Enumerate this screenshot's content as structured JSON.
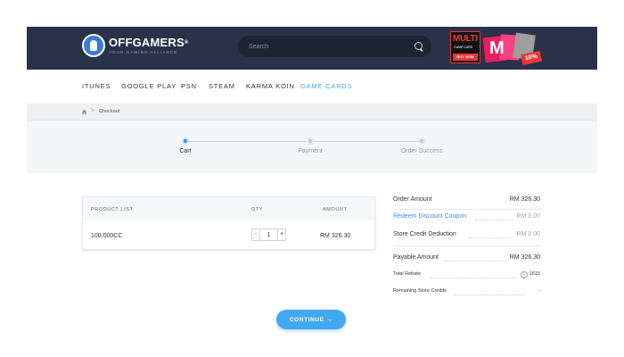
{
  "header": {
    "logo_name": "OFFGAMERS",
    "logo_reg": "®",
    "logo_tagline": "YOUR GAMING ALLIANCE",
    "search_placeholder": "Search",
    "promo": {
      "multi_text": "MULTI",
      "sub_text": "GAME CARD",
      "buy_text": "BUY NOW",
      "m_text": "M",
      "off_text": "10%"
    }
  },
  "nav": {
    "items": [
      {
        "label": "ITUNES",
        "active": false
      },
      {
        "label": "GOOGLE PLAY",
        "active": false
      },
      {
        "label": "PSN",
        "active": false
      },
      {
        "label": "STEAM",
        "active": false
      },
      {
        "label": "KARMA KOIN",
        "active": false
      },
      {
        "label": "GAME CARDS",
        "active": true
      }
    ]
  },
  "breadcrumb": {
    "separator": ">",
    "current": "Checkout"
  },
  "steps": [
    {
      "label": "Cart",
      "active": true
    },
    {
      "label": "Payment",
      "active": false
    },
    {
      "label": "Order Success",
      "active": false
    }
  ],
  "table": {
    "headers": {
      "product": "PRODUCT LIST",
      "qty": "QTY",
      "amount": "AMOUNT"
    },
    "rows": [
      {
        "product": "100,000CC",
        "qty": "1",
        "amount": "RM 326.30"
      }
    ],
    "minus": "-",
    "plus": "+"
  },
  "summary": {
    "order_amount_label": "Order Amount",
    "order_amount_value": "RM 326.30",
    "discount_label": "Redeem Discount Coupon",
    "discount_value": "RM 0.00",
    "store_credit_label": "Store Credit Deduction",
    "store_credit_value": "RM 0.00",
    "payable_label": "Payable Amount",
    "payable_value": "RM 326.30",
    "rebate_label": "Total Rebate",
    "rebate_value": "1615",
    "remaining_label": "Remaining Store Credits",
    "remaining_value": "-"
  },
  "continue_label": "CONTINUE →",
  "colors": {
    "header_bg": "#2b3148",
    "accent": "#42a8f0",
    "link": "#3d8de6"
  }
}
